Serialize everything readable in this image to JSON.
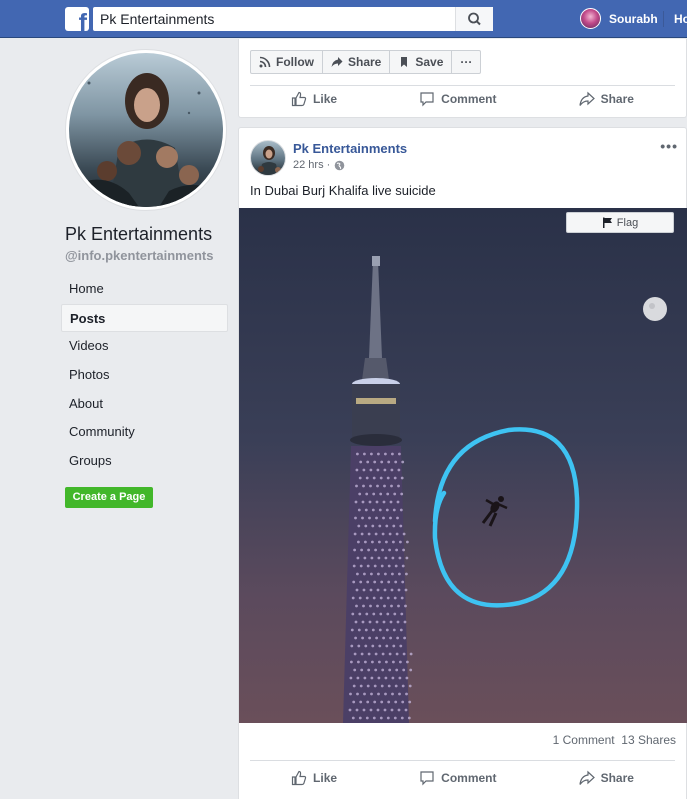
{
  "header": {
    "search_value": "Pk Entertainments",
    "user_name": "Sourabh",
    "home_label": "Home"
  },
  "sidebar": {
    "page_name": "Pk Entertainments",
    "page_handle": "@info.pkentertainments",
    "nav": [
      "Home",
      "Posts",
      "Videos",
      "Photos",
      "About",
      "Community",
      "Groups"
    ],
    "active": "Posts",
    "create_page_label": "Create a Page"
  },
  "page_actions": {
    "follow_label": "Follow",
    "share_label": "Share",
    "save_label": "Save",
    "more_label": "···"
  },
  "post_actions": {
    "like_label": "Like",
    "comment_label": "Comment",
    "share_label": "Share"
  },
  "post": {
    "author": "Pk Entertainments",
    "time": "22 hrs ·",
    "text": "In Dubai Burj Khalifa live suicide",
    "flag_label": "Flag",
    "comments": "1 Comment",
    "shares": "13 Shares"
  },
  "colors": {
    "brand": "#4267b2",
    "create_page_green": "#42b72a",
    "link": "#385898",
    "highlight_circle": "#3ec3f2"
  }
}
